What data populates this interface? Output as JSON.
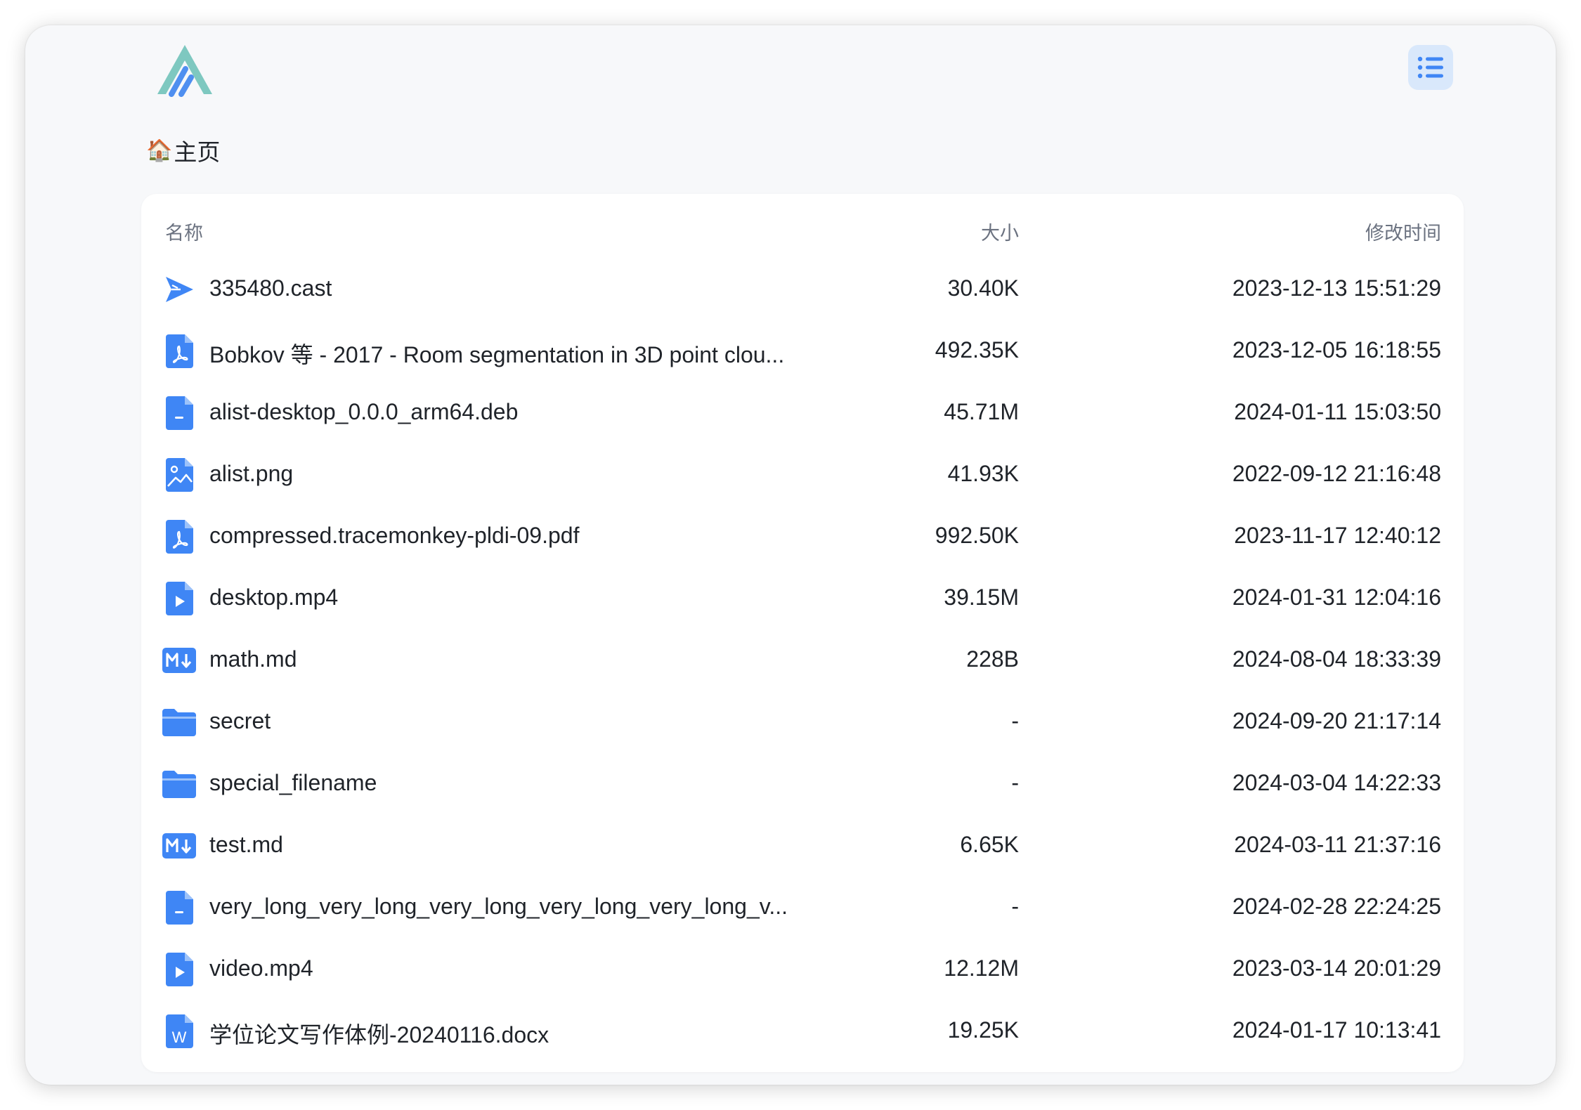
{
  "breadcrumb": {
    "home_emoji": "🏠",
    "home_label": "主页"
  },
  "colors": {
    "accent": "#3f86f5",
    "logo_teal": "#7ec8c0",
    "logo_blue": "#4f8ff0"
  },
  "table": {
    "headers": {
      "name": "名称",
      "size": "大小",
      "modified": "修改时间"
    },
    "rows": [
      {
        "icon": "cast-icon",
        "name": "335480.cast",
        "size": "30.40K",
        "modified": "2023-12-13 15:51:29"
      },
      {
        "icon": "pdf-icon",
        "name": "Bobkov 等 - 2017 - Room segmentation in 3D point clou...",
        "size": "492.35K",
        "modified": "2023-12-05 16:18:55"
      },
      {
        "icon": "file-icon",
        "name": "alist-desktop_0.0.0_arm64.deb",
        "size": "45.71M",
        "modified": "2024-01-11 15:03:50"
      },
      {
        "icon": "image-icon",
        "name": "alist.png",
        "size": "41.93K",
        "modified": "2022-09-12 21:16:48"
      },
      {
        "icon": "pdf-icon",
        "name": "compressed.tracemonkey-pldi-09.pdf",
        "size": "992.50K",
        "modified": "2023-11-17 12:40:12"
      },
      {
        "icon": "video-icon",
        "name": "desktop.mp4",
        "size": "39.15M",
        "modified": "2024-01-31 12:04:16"
      },
      {
        "icon": "markdown-icon",
        "name": "math.md",
        "size": "228B",
        "modified": "2024-08-04 18:33:39"
      },
      {
        "icon": "folder-icon",
        "name": "secret",
        "size": "-",
        "modified": "2024-09-20 21:17:14"
      },
      {
        "icon": "folder-icon",
        "name": "special_filename",
        "size": "-",
        "modified": "2024-03-04 14:22:33"
      },
      {
        "icon": "markdown-icon",
        "name": "test.md",
        "size": "6.65K",
        "modified": "2024-03-11 21:37:16"
      },
      {
        "icon": "file-icon",
        "name": "very_long_very_long_very_long_very_long_very_long_v...",
        "size": "-",
        "modified": "2024-02-28 22:24:25"
      },
      {
        "icon": "video-icon",
        "name": "video.mp4",
        "size": "12.12M",
        "modified": "2023-03-14 20:01:29"
      },
      {
        "icon": "word-icon",
        "name": "学位论文写作体例-20240116.docx",
        "size": "19.25K",
        "modified": "2024-01-17 10:13:41"
      }
    ]
  }
}
